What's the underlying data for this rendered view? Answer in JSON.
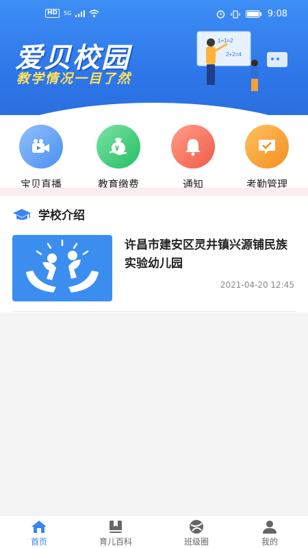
{
  "status_bar": {
    "hd": "HD",
    "network": "5G",
    "time": "9:08"
  },
  "banner": {
    "title": "爱贝校园",
    "subtitle": "教学情况一目了然",
    "board_text_1": "1+1=2",
    "board_text_2": "2+2=4"
  },
  "quick_menu": [
    {
      "label": "宝贝直播",
      "icon": "video-camera-icon",
      "color": "#6aa8f7"
    },
    {
      "label": "教育缴费",
      "icon": "money-bag-icon",
      "color": "#3fcf78"
    },
    {
      "label": "通知",
      "icon": "bell-icon",
      "color": "#f4705d"
    },
    {
      "label": "考勤管理",
      "icon": "checkmark-message-icon",
      "color": "#f7a233"
    }
  ],
  "school_intro": {
    "title": "学校介绍",
    "news": {
      "title": "许昌市建安区灵井镇兴源铺民族实验幼儿园",
      "date": "2021-04-20 12:45"
    }
  },
  "tabs": [
    {
      "label": "首页",
      "icon": "home-icon",
      "active": true
    },
    {
      "label": "育儿百科",
      "icon": "book-icon",
      "active": false
    },
    {
      "label": "班级圈",
      "icon": "class-circle-icon",
      "active": false
    },
    {
      "label": "我的",
      "icon": "profile-icon",
      "active": false
    }
  ],
  "colors": {
    "accent": "#3a86f0",
    "banner": "#2f78ea",
    "subtitle": "#ffe45a"
  }
}
